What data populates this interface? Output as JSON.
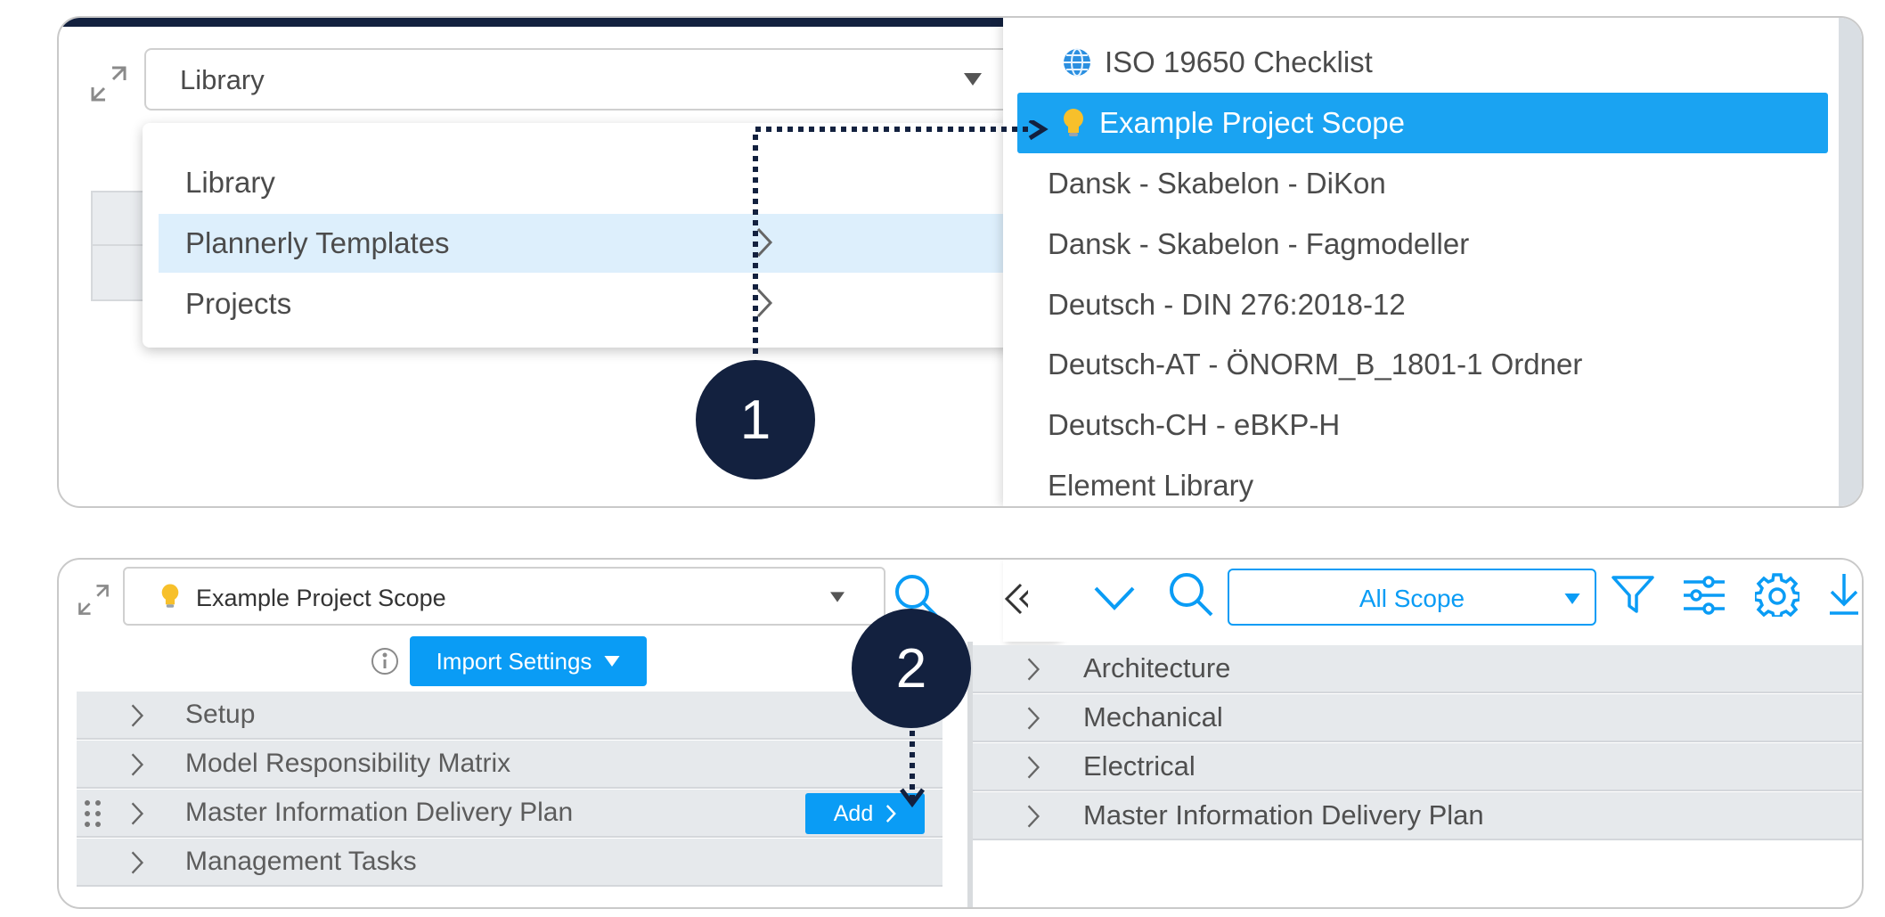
{
  "panel1": {
    "library_select": {
      "value": "Library"
    },
    "menu": {
      "items": [
        {
          "label": "Library",
          "has_submenu": false
        },
        {
          "label": "Plannerly Templates",
          "has_submenu": true,
          "highlighted": true
        },
        {
          "label": "Projects",
          "has_submenu": true
        }
      ]
    },
    "submenu": {
      "items": [
        {
          "label": "ISO 19650 Checklist",
          "icon": "globe-icon",
          "selected": false
        },
        {
          "label": "Example Project Scope",
          "icon": "lightbulb-icon",
          "selected": true
        },
        {
          "label": "Dansk - Skabelon - DiKon"
        },
        {
          "label": "Dansk - Skabelon - Fagmodeller"
        },
        {
          "label": "Deutsch - DIN 276:2018-12"
        },
        {
          "label": "Deutsch-AT - ÖNORM_B_1801-1 Ordner"
        },
        {
          "label": "Deutsch-CH - eBKP-H"
        },
        {
          "label": "Element Library"
        }
      ]
    },
    "callout": "1"
  },
  "panel2": {
    "source_select": {
      "value": "Example Project Scope",
      "icon": "lightbulb-icon"
    },
    "import_settings_label": "Import Settings",
    "left_tree": [
      {
        "label": "Setup"
      },
      {
        "label": "Model Responsibility Matrix"
      },
      {
        "label": "Master Information Delivery Plan",
        "add_label": "Add"
      },
      {
        "label": "Management Tasks"
      }
    ],
    "scope_select": {
      "value": "All Scope"
    },
    "right_tree": [
      {
        "label": "Architecture"
      },
      {
        "label": "Mechanical"
      },
      {
        "label": "Electrical"
      },
      {
        "label": "Master Information Delivery Plan"
      }
    ],
    "callout": "2"
  },
  "colors": {
    "accent": "#0a9cf5",
    "selected_row": "#1aa3f2",
    "menu_highlight": "#ddeffc",
    "callout": "#13213f",
    "row_bg": "#e6e9ec"
  }
}
